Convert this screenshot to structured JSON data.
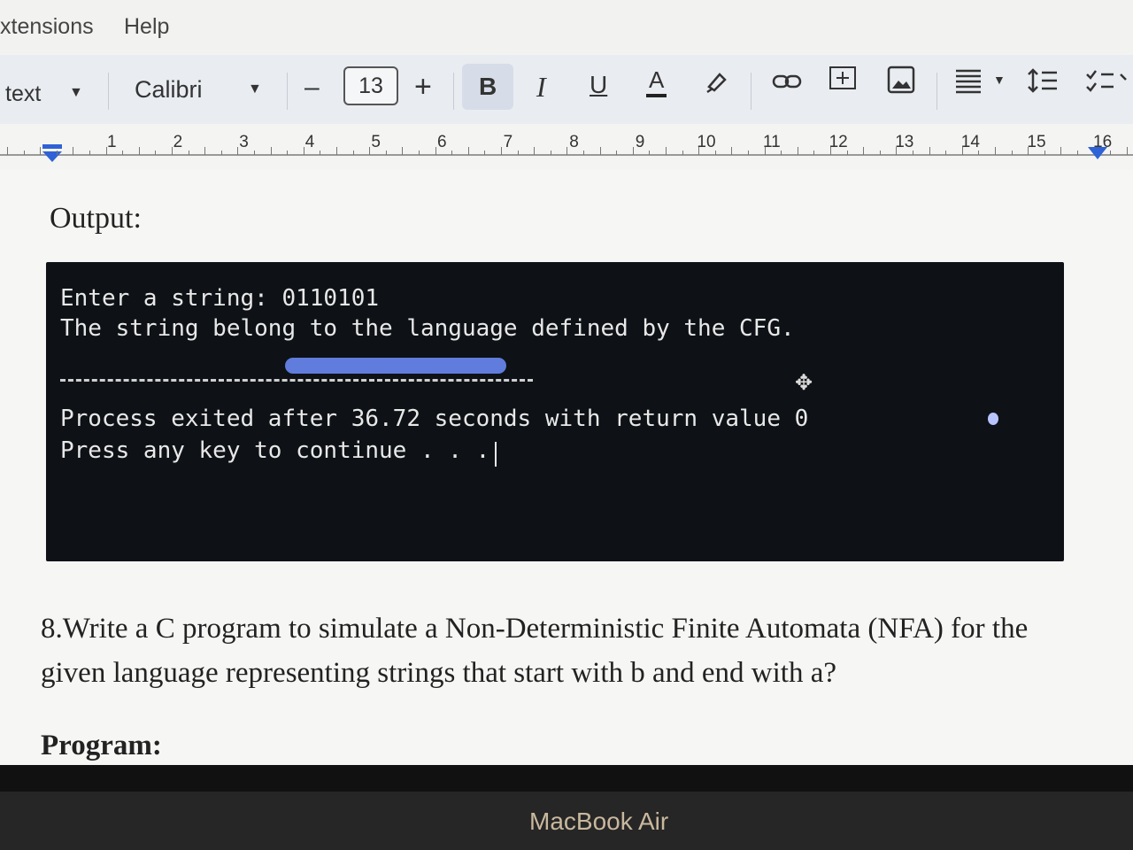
{
  "menu": {
    "items": [
      "xtensions",
      "Help"
    ]
  },
  "toolbar": {
    "style_label": "text",
    "font_name": "Calibri",
    "minus": "–",
    "font_size": "13",
    "plus": "+",
    "bold": "B",
    "italic": "I",
    "underline": "U",
    "text_color": "A"
  },
  "ruler": {
    "numbers": [
      "1",
      "2",
      "3",
      "4",
      "5",
      "6",
      "7",
      "8",
      "9",
      "10",
      "11",
      "12",
      "13",
      "14",
      "15",
      "16"
    ]
  },
  "document": {
    "output_heading": "Output:",
    "terminal": {
      "lines": [
        "Enter a string: 0110101",
        "The string belong to the language defined by the CFG.",
        "Process exited after 36.72 seconds with return value 0",
        "Press any key to continue . . ."
      ]
    },
    "question_line1": "8.Write a C program to simulate a Non-Deterministic Finite Automata (NFA) for the",
    "question_line2": "given language representing strings that start with b and end with a?",
    "program_heading": "Program:"
  },
  "laptop": {
    "brand": "MacBook Air"
  }
}
